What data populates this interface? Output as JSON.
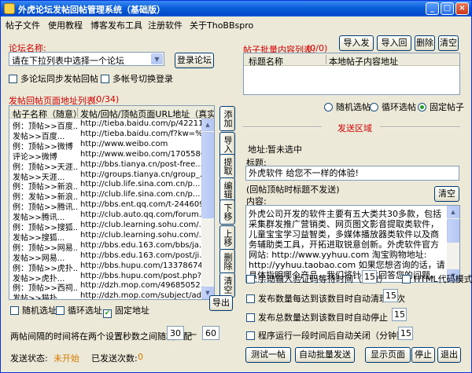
{
  "window": {
    "title": "外虎论坛发帖回帖管理系统（基础版）"
  },
  "menu": [
    "帖子文件",
    "使用教程",
    "博客发布工具",
    "注册软件",
    "关于ThoBBspro"
  ],
  "forum": {
    "label": "论坛名称:",
    "select_value": "请在下拉列表中选择一个论坛",
    "login_button": "登录论坛",
    "sync_reply": "多论坛同步发帖回帖",
    "multi_account": "多帐号切换登录"
  },
  "post_list": {
    "title": "发帖回帖页面地址列表:",
    "count": "(0/34)",
    "headers": [
      "帖子名称（随意）",
      "发帖/回帖/顶帖页面URL地址（真实）"
    ],
    "rows": [
      [
        "例：顶帖>>百度...",
        "http://tieba.baidu.com/p/42211..."
      ],
      [
        "发帖>>百度...",
        "http://tieba.baidu.com/f?kw=%E..."
      ],
      [
        "例：顶帖>>微博",
        "http://www.weibo.com"
      ],
      [
        "评论>>微博",
        "http://www.weibo.com/170558612..."
      ],
      [
        "例：顶帖>>天涯...",
        "http://bbs.tianya.cn/post-free..."
      ],
      [
        "发帖>>天涯...",
        "http://groups.tianya.cn/group_..."
      ],
      [
        "例：顶帖>>新浪...",
        "http://club.life.sina.com.cn/p..."
      ],
      [
        "例：发帖>>新浪...",
        "http://club.life.sina.com.cn/p..."
      ],
      [
        "例：顶帖>>腾讯...",
        "http://bbs.ent.qq.com/t-244609..."
      ],
      [
        "发帖>>腾讯...",
        "http://club.auto.qq.com/forum..."
      ],
      [
        "例：顶帖>>搜狐...",
        "http://club.learning.sohu.com/..."
      ],
      [
        "发帖>>搜狐...",
        "http://club.learning.sohu.com/..."
      ],
      [
        "例：顶帖>>网易...",
        "http://bbs.edu.163.com/bbs/ja..."
      ],
      [
        "发帖>>网易...",
        "http://bbs.edu.163.com/post/ji..."
      ],
      [
        "例：顶帖>>虎扑...",
        "http://bbs.hupu.com/13378674.html"
      ],
      [
        "发帖>>虎扑...",
        "http://bbs.hupu.com/post.php?f..."
      ],
      [
        "例：顶帖>>西祠...",
        "http://dzh.mop.com/49685052.ht..."
      ],
      [
        "发帖>>猫扑...",
        "http://dzh.mop.com/subject/add"
      ],
      [
        "例：顶帖>>淘宝...",
        "http://bbs.taobao.com/catalog/..."
      ],
      [
        "发帖>>淘宝...",
        "http://bbs.taobao.com/catalog/..."
      ],
      [
        "例：顶帖>>阿里...",
        "http://club.1688.com/threadvie..."
      ],
      [
        "发帖>>阿里...",
        "http://club.1688.com/thread/ad..."
      ],
      [
        "例：顶帖>>新...",
        "http://www.xici.net/d221520890..."
      ]
    ],
    "side_buttons": [
      "添加",
      "导入",
      "提取",
      "编辑",
      "下移",
      "上移",
      "删除",
      "清空"
    ],
    "export_button": "导出",
    "random_site": "随机选址",
    "loop_site": "循环选址",
    "fixed_site": "固定地址",
    "interval_label": "两帖间隔的时间将在两个设置秒数之间随机分配",
    "interval_min": "30",
    "interval_dash": "一",
    "interval_max": "60"
  },
  "status": {
    "state_label": "发送状态:",
    "state_value": "未开始",
    "count_label": "已发送次数:",
    "count_value": "0"
  },
  "batch": {
    "title": "帖子批量内容列表:",
    "count": "(0/0)",
    "buttons": [
      "导入发帖",
      "导入回帖",
      "删除",
      "清空"
    ],
    "headers": [
      "标题名称",
      "本地帖子内容地址"
    ],
    "mode_random": "随机选帖",
    "mode_loop": "循环选帖",
    "mode_fixed": "固定帖子"
  },
  "send_area": {
    "section_title": "发送区域",
    "address_label": "地址:",
    "address_value": "暂未选中",
    "title_label": "标题:",
    "title_value": "外虎软件 给您不一样的体验!",
    "title_hint": "(回帖顶帖时标题不发送)",
    "clear_button": "清空",
    "content_label": "内容:",
    "content_value": "外虎公司开发的软件主要有五大类共30多款，包括采集群发推广营销类、网页图文影音提取类软件，儿童宝宝学习益智类，多媒体播放器类软件以及商务辅助类工具，开拓进取锐意创新。外虎软件官方网站: http://www.yyhuu.com 淘宝购物地址: http://yyhuu.taobao.com 如果您想咨询的话，请具体指明哪个产品，我们将针对性回答您的问题，谢谢!"
  },
  "options": {
    "manual_captcha": "手动输入验证码等待时间（秒数）",
    "manual_captcha_value": "15",
    "html_mode": "HTML代码模式",
    "auto_clear": "发布数量每达到该数目时自动清理一次",
    "auto_clear_value": "15",
    "auto_stop": "发布总数量达到该数目时自动停止",
    "auto_stop_value": "15",
    "auto_close": "程序运行一段时间后自动关闭（分钟数）",
    "auto_close_value": "15"
  },
  "actions": [
    "测试一帖",
    "自动批量发送",
    "显示页面",
    "停止",
    "退出"
  ]
}
